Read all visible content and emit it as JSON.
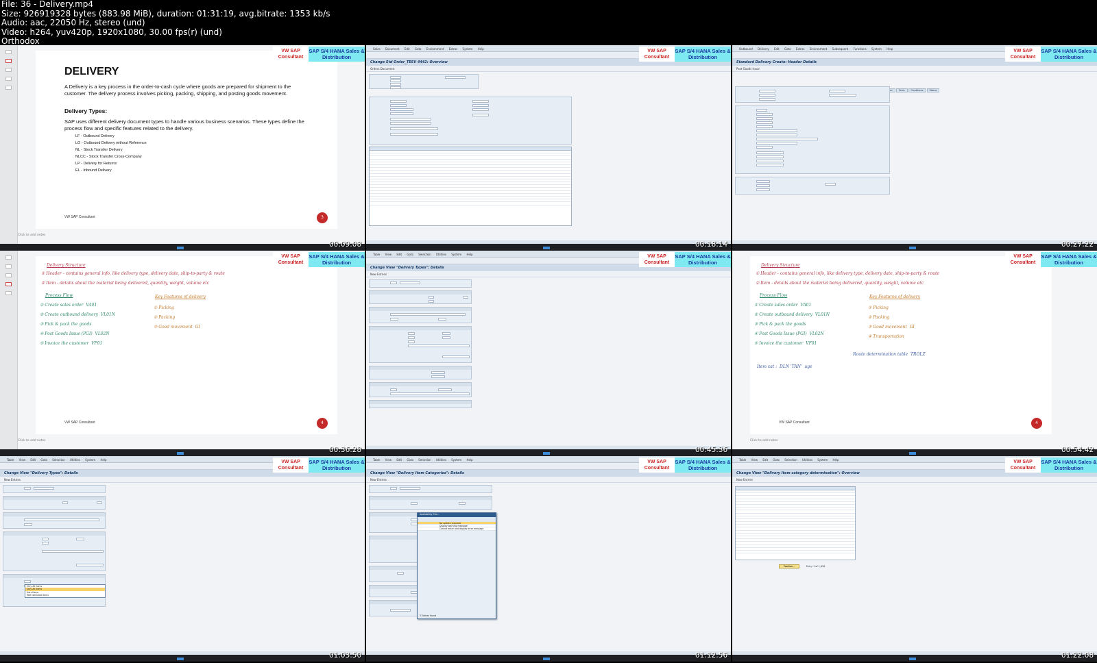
{
  "header": {
    "line1": "File: 36 - Delivery.mp4",
    "line2": "Size: 926919328 bytes (883.98 MiB), duration: 01:31:19, avg.bitrate: 1353 kb/s",
    "line3": "Audio: aac, 22050 Hz, stereo (und)",
    "line4": "Video: h264, yuv420p, 1920x1080, 30.00 fps(r) (und)",
    "line5": "Orthodox"
  },
  "brand": {
    "vw": "VW SAP Consultant",
    "sap": "SAP S/4 HANA Sales & Distribution"
  },
  "thumbs": {
    "t1": {
      "timestamp": "00:09:08",
      "title": "DELIVERY",
      "para": "A Delivery is a key process in the order-to-cash cycle where goods are prepared for shipment to the customer. The delivery process involves picking, packing, shipping, and posting goods movement.",
      "subtitle": "Delivery Types:",
      "para2": "SAP uses different delivery document types to handle various business scenarios. These types define the process flow and specific features related to the delivery.",
      "types": [
        "LF - Outbound Delivery",
        "LO - Outbound Delivery without Reference",
        "NL - Stock Transfer Delivery",
        "NLCC - Stock Transfer Cross-Company",
        "LP - Delivery for Returns",
        "EL - Inbound Delivery"
      ],
      "footer": "VW SAP Consultant",
      "page": "3",
      "notes": "Click to add notes"
    },
    "t2": {
      "timestamp": "00:18:14",
      "title": "Change Std Order_TESV 4442: Overview"
    },
    "t3": {
      "timestamp": "00:27:22",
      "title": "Standard Delivery  Create: Header Details"
    },
    "t4": {
      "timestamp": "00:36:28",
      "heading": "Delivery Structure",
      "line_a": "① Header - contains general info, like delivery type, delivery date, ship-to-party & route",
      "line_b": "② Item - details about the material being delivered, quantity, weight, volume etc",
      "flow_title": "Process Flow",
      "flow": [
        "① Create sales order  VA01",
        "② Create outbound delivery  VL01N",
        "③ Pick & pack the goods",
        "④ Post Goods Issue (PGI)  VL02N",
        "⑤ Invoice the customer  VF01"
      ],
      "feat_title": "Key Features of delivery",
      "feat": [
        "① Picking",
        "② Packing",
        "③ Good movement  GI"
      ],
      "footer": "VW SAP Consultant",
      "page": "4",
      "notes": "Click to add notes"
    },
    "t5": {
      "timestamp": "00:45:36",
      "title": "Change View \"Delivery Types\": Details"
    },
    "t6": {
      "timestamp": "00:54:42",
      "feat_extra": "④ Transportation",
      "route": "Route determination table  TROLZ",
      "item": "Item cat :  DLN 'TAN'  uge",
      "page": "4",
      "footer": "VW SAP Consultant",
      "notes": "Click to add notes"
    },
    "t7": {
      "timestamp": "01:03:50",
      "title": "Change View \"Delivery Types\": Details",
      "dropdown": [
        "Only All Items",
        "Only All Items",
        "Hdrs Items",
        "With Selected Items"
      ]
    },
    "t8": {
      "timestamp": "01:12:56",
      "title": "Change View \"Delivery Item Categories\": Details",
      "popup_title": "Availability Chk...",
      "popup_rows": [
        "No update required",
        "Display warning message",
        "Cannot enter and display error message"
      ],
      "popup_footer": "3 Entries found"
    },
    "t9": {
      "timestamp": "01:22:08",
      "title": "Change View \"Delivery Item category determination\": Overview",
      "position": "Position...",
      "entry": "Entry 1 of 1,456"
    }
  }
}
